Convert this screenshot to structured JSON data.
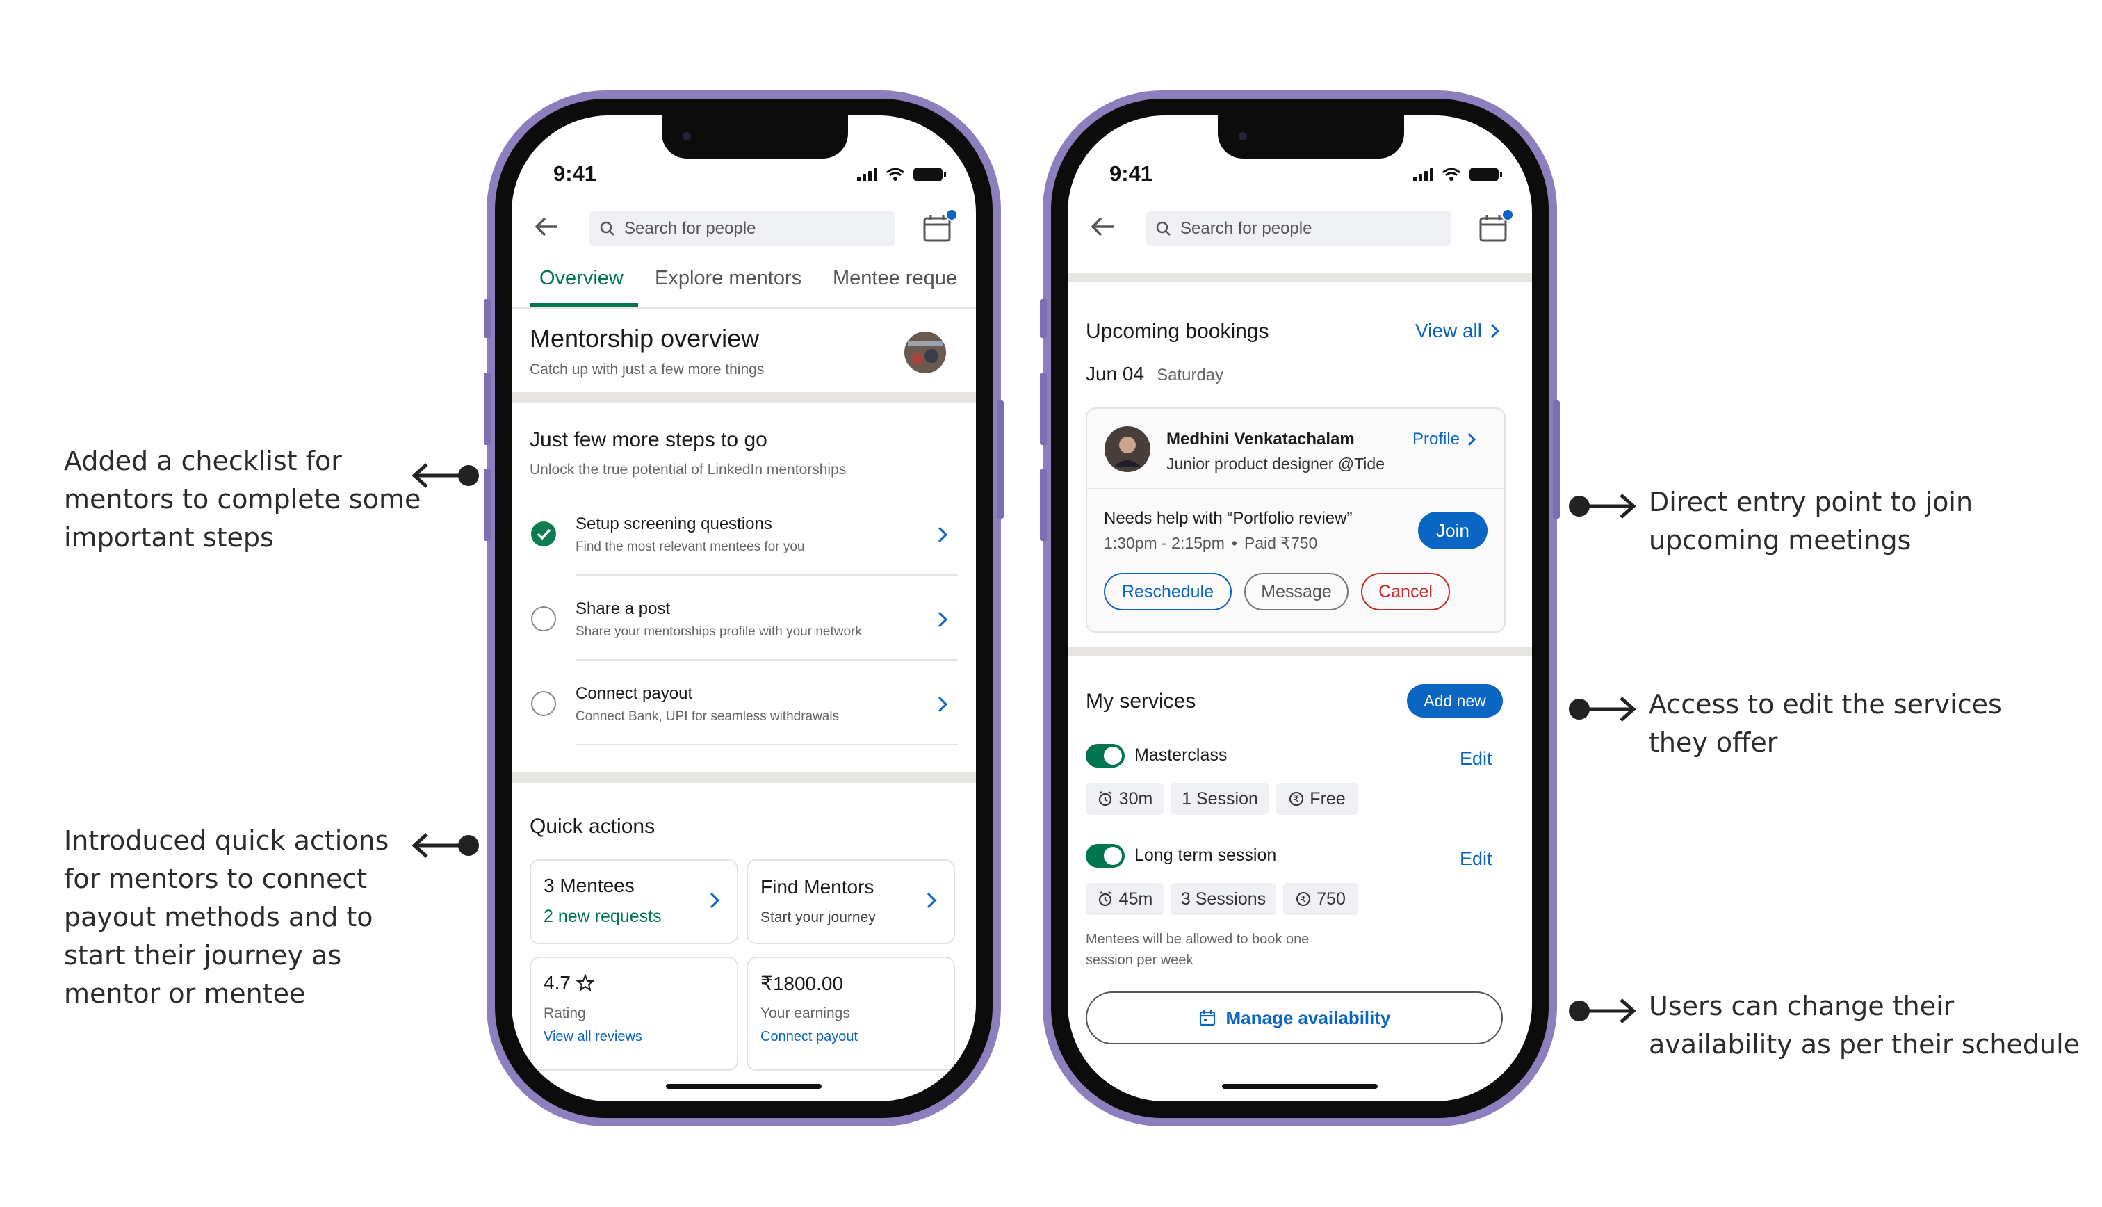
{
  "annotations": {
    "checklist": [
      "Added a checklist for",
      "mentors to complete some",
      "important steps"
    ],
    "quick_actions": [
      "Introduced quick actions",
      "for mentors to connect",
      "payout methods and to",
      "start their journey as",
      "mentor or mentee"
    ],
    "join": [
      "Direct entry point to join",
      "upcoming meetings"
    ],
    "services": [
      "Access to edit the services",
      "they offer"
    ],
    "availability": [
      "Users can change their",
      "availability as per their schedule"
    ]
  },
  "status_bar": {
    "time": "9:41"
  },
  "search": {
    "placeholder": "Search for people"
  },
  "tabs": [
    "Overview",
    "Explore mentors",
    "Mentee reque"
  ],
  "overview": {
    "title": "Mentorship overview",
    "subtitle": "Catch up with just a few more things"
  },
  "checklist": {
    "title": "Just few more steps to go",
    "subtitle": "Unlock the true potential of LinkedIn mentorships",
    "items": [
      {
        "title": "Setup screening questions",
        "desc": "Find the most relevant mentees for you",
        "done": true
      },
      {
        "title": "Share a post",
        "desc": "Share your mentorships profile with your network",
        "done": false
      },
      {
        "title": "Connect payout",
        "desc": "Connect Bank, UPI for seamless withdrawals",
        "done": false
      }
    ]
  },
  "quick_actions": {
    "title": "Quick actions",
    "mentees": {
      "title": "3 Mentees",
      "link": "2 new requests"
    },
    "find": {
      "title": "Find Mentors",
      "sub": "Start your journey"
    },
    "rating": {
      "value": "4.7",
      "label": "Rating",
      "link": "View all reviews"
    },
    "earnings": {
      "value": "₹1800.00",
      "label": "Your earnings",
      "link": "Connect payout"
    }
  },
  "bookings": {
    "title": "Upcoming bookings",
    "view_all": "View all",
    "date": "Jun 04",
    "day": "Saturday",
    "person": {
      "name": "Medhini Venkatachalam",
      "role": "Junior product designer @Tide"
    },
    "profile_link": "Profile",
    "topic": "Needs help with “Portfolio review”",
    "time": "1:30pm - 2:15pm",
    "paid": "Paid ₹750",
    "join": "Join",
    "reschedule": "Reschedule",
    "message": "Message",
    "cancel": "Cancel"
  },
  "services": {
    "title": "My services",
    "add_new": "Add new",
    "items": [
      {
        "name": "Masterclass",
        "duration": "30m",
        "sessions": "1 Session",
        "price": "Free",
        "edit": "Edit"
      },
      {
        "name": "Long term session",
        "duration": "45m",
        "sessions": "3 Sessions",
        "price": "750",
        "edit": "Edit"
      }
    ],
    "note": [
      "Mentees will be allowed to book one",
      "session per week"
    ],
    "manage": "Manage availability"
  },
  "colors": {
    "linkedin_blue": "#0a66c2",
    "green": "#01754f",
    "frame": "#8d7fbe"
  }
}
